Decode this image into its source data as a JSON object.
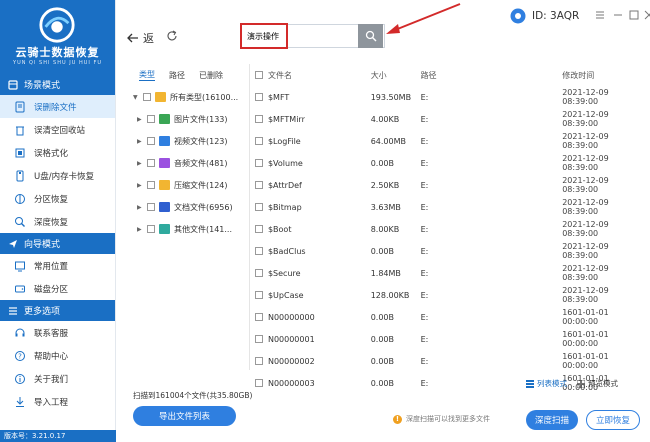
{
  "app": {
    "title": "云骑士数据恢复",
    "subtitle": "YUN QI SHI SHU JU HUI FU",
    "version": "版本号：3.21.0.17",
    "user_id": "ID: 3AQR"
  },
  "sidebar": {
    "sections": [
      {
        "title": "场景模式",
        "icon": "scene-icon",
        "items": [
          {
            "label": "误删除文件",
            "icon": "recycle-file-icon",
            "active": true
          },
          {
            "label": "误清空回收站",
            "icon": "trash-icon",
            "active": false
          },
          {
            "label": "误格式化",
            "icon": "format-icon",
            "active": false
          },
          {
            "label": "U盘/内存卡恢复",
            "icon": "usb-icon",
            "active": false
          },
          {
            "label": "分区恢复",
            "icon": "partition-icon",
            "active": false
          },
          {
            "label": "深度恢复",
            "icon": "deep-icon",
            "active": false
          }
        ]
      },
      {
        "title": "向导模式",
        "icon": "guide-icon",
        "items": [
          {
            "label": "常用位置",
            "icon": "location-icon",
            "active": false
          },
          {
            "label": "磁盘分区",
            "icon": "disk-icon",
            "active": false
          }
        ]
      },
      {
        "title": "更多选项",
        "icon": "menu-icon",
        "items": [
          {
            "label": "联系客服",
            "icon": "headset-icon",
            "active": false
          },
          {
            "label": "帮助中心",
            "icon": "help-icon",
            "active": false
          },
          {
            "label": "关于我们",
            "icon": "info-icon",
            "active": false
          },
          {
            "label": "导入工程",
            "icon": "import-icon",
            "active": false
          }
        ]
      }
    ]
  },
  "topbar": {
    "back_label": "返",
    "search": {
      "value": "演示操作",
      "placeholder": ""
    }
  },
  "tree": {
    "tabs": [
      "类型",
      "路径",
      "已删除"
    ],
    "active_tab": 0,
    "rows": [
      {
        "label": "所有类型(16100...",
        "icon": "folder-icon",
        "color": "#f2b531",
        "expanded": true
      },
      {
        "label": "图片文件(133)",
        "icon": "image-file-icon",
        "color": "#3aa655"
      },
      {
        "label": "视频文件(123)",
        "icon": "video-file-icon",
        "color": "#2f7fe0"
      },
      {
        "label": "音频文件(481)",
        "icon": "audio-file-icon",
        "color": "#9b51e0"
      },
      {
        "label": "压缩文件(124)",
        "icon": "archive-file-icon",
        "color": "#f2b531"
      },
      {
        "label": "文档文件(6956)",
        "icon": "doc-file-icon",
        "color": "#2f5fd0"
      },
      {
        "label": "其他文件(141...",
        "icon": "other-file-icon",
        "color": "#2faa9e"
      }
    ]
  },
  "table": {
    "columns": [
      "文件名",
      "大小",
      "路径",
      "修改时间"
    ],
    "rows": [
      {
        "name": "$MFT",
        "size": "193.50MB",
        "path": "E:",
        "time": "2021-12-09 08:39:00"
      },
      {
        "name": "$MFTMirr",
        "size": "4.00KB",
        "path": "E:",
        "time": "2021-12-09 08:39:00"
      },
      {
        "name": "$LogFile",
        "size": "64.00MB",
        "path": "E:",
        "time": "2021-12-09 08:39:00"
      },
      {
        "name": "$Volume",
        "size": "0.00B",
        "path": "E:",
        "time": "2021-12-09 08:39:00"
      },
      {
        "name": "$AttrDef",
        "size": "2.50KB",
        "path": "E:",
        "time": "2021-12-09 08:39:00"
      },
      {
        "name": "$Bitmap",
        "size": "3.63MB",
        "path": "E:",
        "time": "2021-12-09 08:39:00"
      },
      {
        "name": "$Boot",
        "size": "8.00KB",
        "path": "E:",
        "time": "2021-12-09 08:39:00"
      },
      {
        "name": "$BadClus",
        "size": "0.00B",
        "path": "E:",
        "time": "2021-12-09 08:39:00"
      },
      {
        "name": "$Secure",
        "size": "1.84MB",
        "path": "E:",
        "time": "2021-12-09 08:39:00"
      },
      {
        "name": "$UpCase",
        "size": "128.00KB",
        "path": "E:",
        "time": "2021-12-09 08:39:00"
      },
      {
        "name": "N00000000",
        "size": "0.00B",
        "path": "E:",
        "time": "1601-01-01 00:00:00"
      },
      {
        "name": "N00000001",
        "size": "0.00B",
        "path": "E:",
        "time": "1601-01-01 00:00:00"
      },
      {
        "name": "N00000002",
        "size": "0.00B",
        "path": "E:",
        "time": "1601-01-01 00:00:00"
      },
      {
        "name": "N00000003",
        "size": "0.00B",
        "path": "E:",
        "time": "1601-01-01 00:00:00"
      }
    ]
  },
  "bottom": {
    "scan_info": "扫描到161004个文件(共35.80GB)",
    "export_label": "导出文件列表",
    "view_list": "列表模式",
    "view_preview": "预览模式",
    "tip": "深度扫描可以找到更多文件",
    "deep_scan": "深度扫描",
    "recover": "立即恢复"
  },
  "colors": {
    "brand": "#1a6fc4",
    "accent": "#2f7fe0",
    "highlight": "#d32a2a"
  }
}
